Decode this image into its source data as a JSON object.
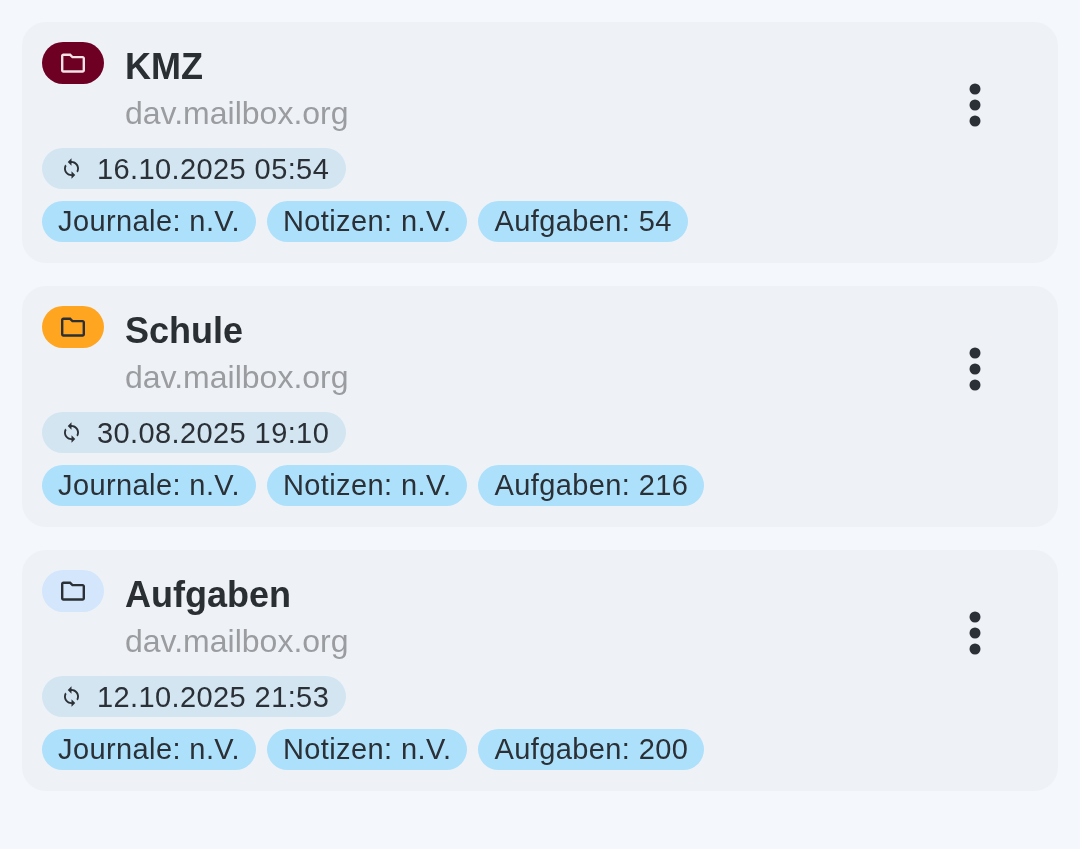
{
  "collections": [
    {
      "name": "KMZ",
      "server": "dav.mailbox.org",
      "color": "#6e0023",
      "last_sync": "16.10.2025 05:54",
      "counts": [
        "Journale: n.V.",
        "Notizen: n.V.",
        "Aufgaben: 54"
      ]
    },
    {
      "name": "Schule",
      "server": "dav.mailbox.org",
      "color": "#ffa51f",
      "last_sync": "30.08.2025 19:10",
      "counts": [
        "Journale: n.V.",
        "Notizen: n.V.",
        "Aufgaben: 216"
      ]
    },
    {
      "name": "Aufgaben",
      "server": "dav.mailbox.org",
      "color": "#d3e6fb",
      "last_sync": "12.10.2025 21:53",
      "counts": [
        "Journale: n.V.",
        "Notizen: n.V.",
        "Aufgaben: 200"
      ]
    }
  ]
}
